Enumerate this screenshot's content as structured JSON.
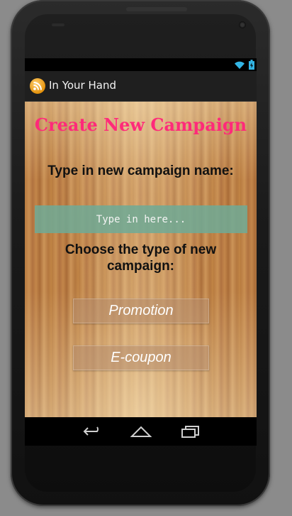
{
  "app": {
    "title": "In Your Hand"
  },
  "main": {
    "heading": "Create New Campaign",
    "name_prompt": "Type in new campaign name:",
    "name_input": {
      "value": "",
      "placeholder": "Type in here..."
    },
    "type_prompt": "Choose the type of new campaign:",
    "type_buttons": [
      {
        "label": "Promotion"
      },
      {
        "label": "E-coupon"
      }
    ]
  },
  "colors": {
    "heading": "#ff2a7a",
    "input_bg": "#6eaa96",
    "actionbar_bg": "#1f1f1f",
    "status_icons": "#33b5e5"
  },
  "icons": {
    "app": "rss-icon",
    "status": [
      "wifi-icon",
      "battery-icon"
    ],
    "nav": [
      "back-icon",
      "home-icon",
      "recent-apps-icon"
    ]
  }
}
